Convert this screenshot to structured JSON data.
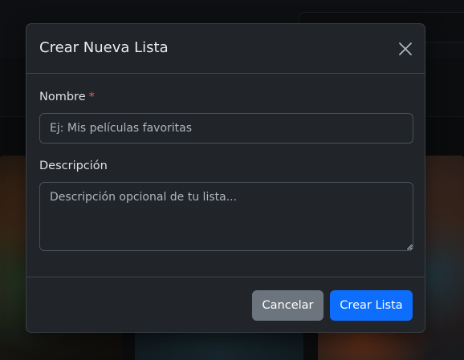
{
  "modal": {
    "title": "Crear Nueva Lista",
    "fields": {
      "name": {
        "label": "Nombre",
        "required_marker": "*",
        "value": "",
        "placeholder": "Ej: Mis películas favoritas"
      },
      "description": {
        "label": "Descripción",
        "value": "",
        "placeholder": "Descripción opcional de tu lista..."
      }
    },
    "buttons": {
      "cancel": "Cancelar",
      "create": "Crear Lista"
    }
  },
  "colors": {
    "primary": "#0d6efd",
    "secondary": "#6c757d",
    "danger": "#e35d6a",
    "modal_bg": "#212529"
  },
  "icons": {
    "close": "close-icon"
  }
}
